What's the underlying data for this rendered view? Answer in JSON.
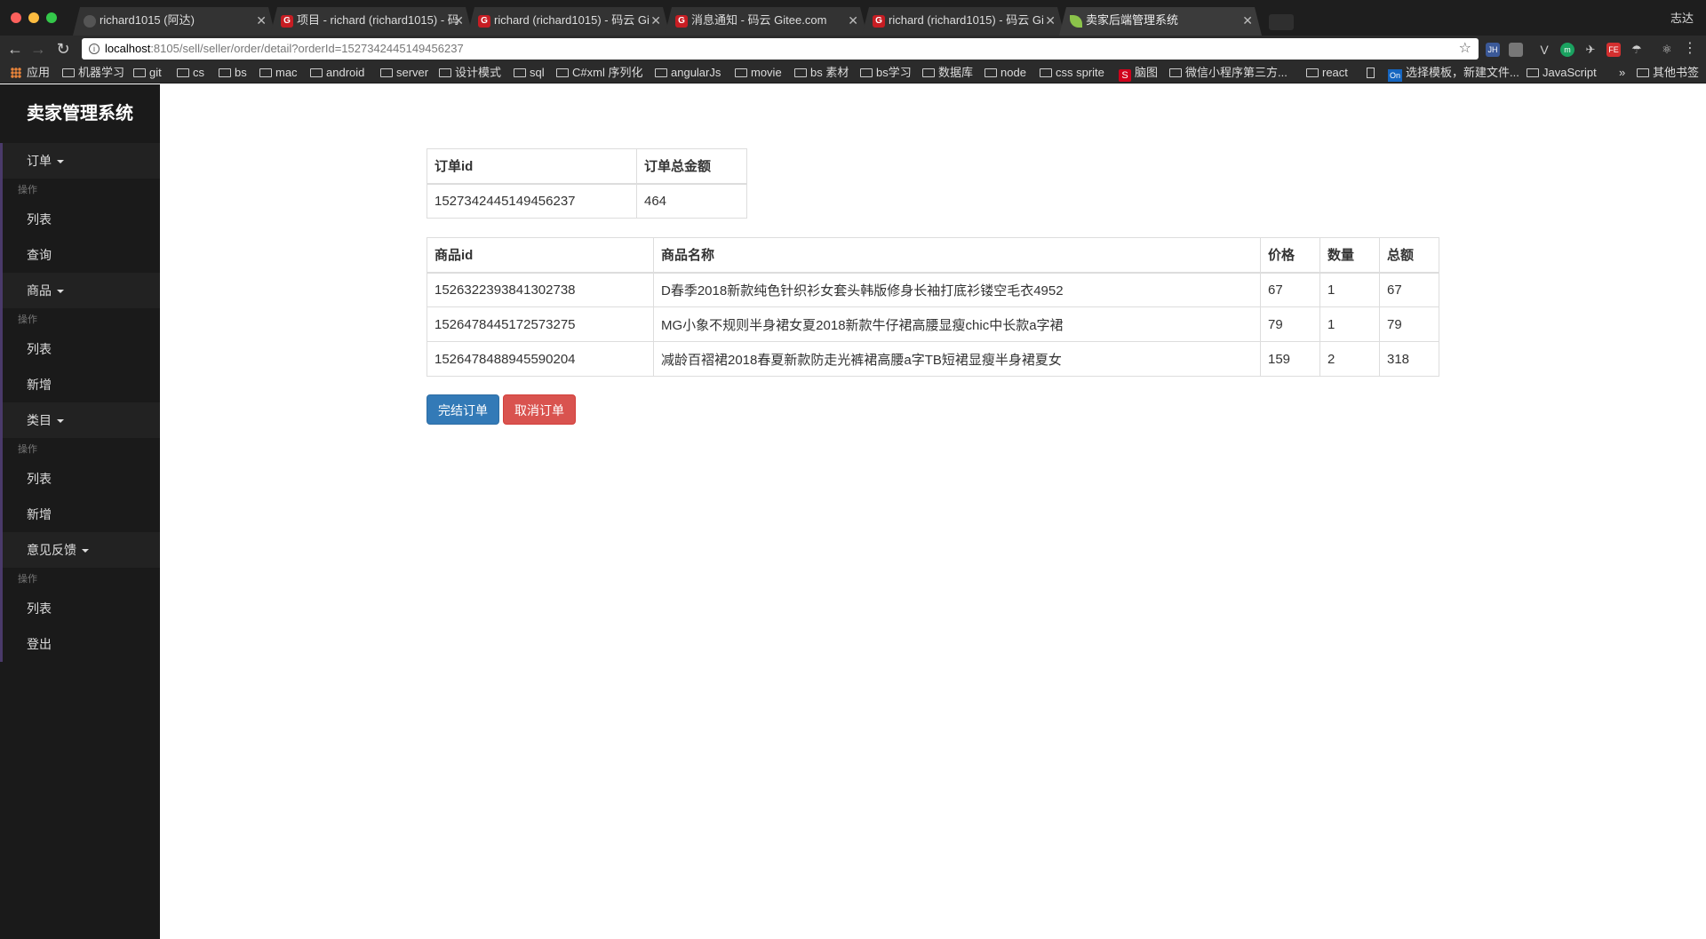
{
  "browser": {
    "tabs": [
      {
        "title": "richard1015 (阿达)",
        "icon": "github-icon"
      },
      {
        "title": "项目 - richard (richard1015) - 码",
        "icon": "gitee-icon"
      },
      {
        "title": "richard (richard1015) - 码云 Gi",
        "icon": "gitee-icon"
      },
      {
        "title": "消息通知 - 码云 Gitee.com",
        "icon": "gitee-icon"
      },
      {
        "title": "richard (richard1015) - 码云 Gi",
        "icon": "gitee-icon"
      },
      {
        "title": "卖家后端管理系统",
        "icon": "leaf-icon"
      }
    ],
    "profile": "志达",
    "url_host": "localhost",
    "url_rest": ":8105/sell/seller/order/detail?orderId=1527342445149456237",
    "bookmarks": [
      "应用",
      "机器学习",
      "git",
      "cs",
      "bs",
      "mac",
      "android",
      "server",
      "设计模式",
      "sql",
      "C#xml 序列化",
      "angularJs",
      "movie",
      "bs 素材",
      "bs学习",
      "数据库",
      "node",
      "css sprite",
      "脑图",
      "微信小程序第三方...",
      "react",
      "",
      "选择模板，新建文件...",
      "JavaScript",
      "»",
      "其他书签"
    ]
  },
  "sidebar": {
    "brand": "卖家管理系统",
    "sections": [
      {
        "label": "订单",
        "header": "操作",
        "items": [
          "列表",
          "查询"
        ]
      },
      {
        "label": "商品",
        "header": "操作",
        "items": [
          "列表",
          "新增"
        ]
      },
      {
        "label": "类目",
        "header": "操作",
        "items": [
          "列表",
          "新增"
        ]
      },
      {
        "label": "意见反馈",
        "header": "操作",
        "items": [
          "列表"
        ]
      }
    ],
    "logout": "登出"
  },
  "order": {
    "headers": [
      "订单id",
      "订单总金额"
    ],
    "row": [
      "1527342445149456237",
      "464"
    ]
  },
  "items": {
    "headers": [
      "商品id",
      "商品名称",
      "价格",
      "数量",
      "总额"
    ],
    "rows": [
      [
        "1526322393841302738",
        "D春季2018新款纯色针织衫女套头韩版修身长袖打底衫镂空毛衣4952",
        "67",
        "1",
        "67"
      ],
      [
        "1526478445172573275",
        "MG小象不规则半身裙女夏2018新款牛仔裙高腰显瘦chic中长款a字裙",
        "79",
        "1",
        "79"
      ],
      [
        "1526478488945590204",
        "减龄百褶裙2018春夏新款防走光裤裙高腰a字TB短裙显瘦半身裙夏女",
        "159",
        "2",
        "318"
      ]
    ]
  },
  "actions": {
    "finish": "完结订单",
    "cancel": "取消订单"
  },
  "colors": {
    "primary": "#337ab7",
    "danger": "#d9534f",
    "sidebar": "#1a1a1a"
  }
}
